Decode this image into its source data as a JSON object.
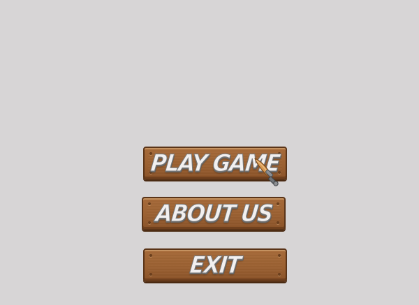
{
  "menu": {
    "buttons": [
      {
        "label": "PLAY GAME"
      },
      {
        "label": "ABOUT US"
      },
      {
        "label": "EXIT"
      }
    ]
  },
  "cursor": {
    "icon": "sword-cursor-icon"
  },
  "colors": {
    "background": "#d7d5d6",
    "wood": "#9b6132",
    "wood_border": "#5a3418",
    "label": "#f2f0f0"
  }
}
